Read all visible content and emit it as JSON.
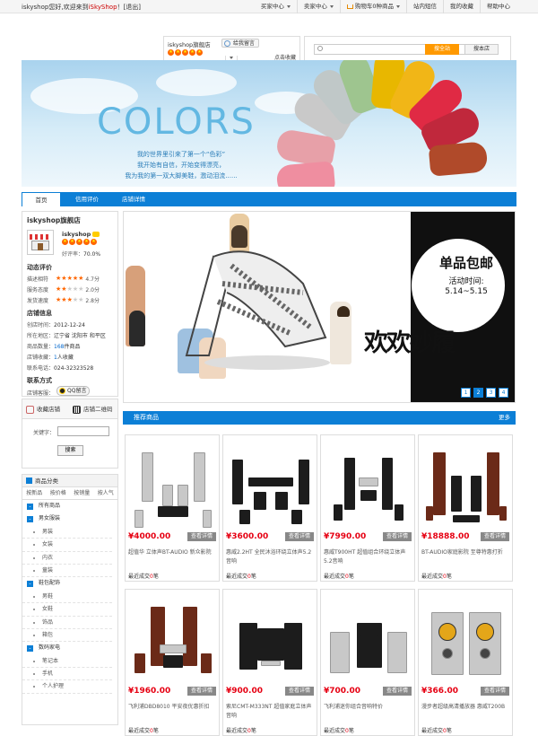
{
  "topbar": {
    "welcome_prefix": "iskyshop您好,欢迎来到",
    "welcome_shop": "iSkyShop",
    "welcome_suffix": "！[退出]",
    "nav": [
      "买家中心",
      "卖家中心",
      "购物车0种商品",
      "站内短信",
      "我的收藏",
      "帮助中心"
    ]
  },
  "header": {
    "shop_name": "iskyshop旗舰店",
    "fav_label": "给我留言",
    "collect_label": "点击收藏",
    "search_placeholder": "",
    "search_all_label": "搜全站",
    "search_shop_label": "搜本店"
  },
  "banner": {
    "headline": "COLORS",
    "slogan_1": "我的世界里引来了第一个“色彩”",
    "slogan_2": "我开始有自信，开始变得漂亮，",
    "slogan_3": "我为我的第一双大脚美鞋，激动泪流......"
  },
  "navbar": {
    "tabs": [
      "首页",
      "信用评价",
      "店铺详情"
    ]
  },
  "shop": {
    "title": "iskyshop旗舰店",
    "seller": "iskyshop",
    "rate_label": "好评率：",
    "rate_value": "70.0%",
    "dsr_title": "动态评价",
    "dsr": [
      {
        "label": "描述相符",
        "stars": 5,
        "score": "4.7分"
      },
      {
        "label": "服务态度",
        "stars": 2,
        "score": "2.0分"
      },
      {
        "label": "发货速度",
        "stars": 3,
        "score": "2.8分"
      }
    ],
    "info_title": "店铺信息",
    "info": [
      {
        "label": "创店时间：",
        "value": "2012-12-24"
      },
      {
        "label": "所在地区：",
        "value": "辽宁省 沈阳市 和平区"
      },
      {
        "label": "商品数量：",
        "value": "168件商品",
        "hl": "168"
      },
      {
        "label": "店铺收藏：",
        "value": "1人收藏",
        "hl": "1"
      },
      {
        "label": "联系电话：",
        "value": "024-32323528"
      }
    ],
    "contact_title": "联系方式",
    "service_label": "店铺客服：",
    "qq_label": "QQ留言"
  },
  "tools": {
    "fav_shop": "收藏店铺",
    "qr_code": "店铺二维码"
  },
  "shop_search": {
    "keyword_label": "关键字：",
    "button": "搜索"
  },
  "categories": {
    "title": "商品分类",
    "sorts": [
      "按新品",
      "按价格",
      "按销量",
      "按人气"
    ],
    "items": [
      {
        "type": "top",
        "label": "所有商品"
      },
      {
        "type": "top",
        "label": "男女服装"
      },
      {
        "type": "sub",
        "label": "男装"
      },
      {
        "type": "sub",
        "label": "女装"
      },
      {
        "type": "sub",
        "label": "内衣"
      },
      {
        "type": "sub",
        "label": "童装"
      },
      {
        "type": "top",
        "label": "鞋包配饰"
      },
      {
        "type": "sub",
        "label": "男鞋"
      },
      {
        "type": "sub",
        "label": "女鞋"
      },
      {
        "type": "sub",
        "label": "饰品"
      },
      {
        "type": "sub",
        "label": "箱包"
      },
      {
        "type": "top",
        "label": "数码家电"
      },
      {
        "type": "sub",
        "label": "笔记本"
      },
      {
        "type": "sub",
        "label": "手机"
      },
      {
        "type": "sub",
        "label": "个人护理"
      }
    ]
  },
  "promo": {
    "badge_title": "单品包邮",
    "badge_line1": "活动时间:",
    "badge_line2": "5.14~5.15",
    "slogan": "欢欢妙履",
    "pages": [
      "1",
      "2",
      "3",
      "4"
    ],
    "active_page": "2"
  },
  "recommend": {
    "title": "推荐商品",
    "more": "更多",
    "detail_label": "查看详情",
    "sold_prefix": "最近成交",
    "sold_suffix": "笔",
    "products": [
      {
        "price": "¥4000.00",
        "name": "超值华 立体声BT-AUDIO 新众影院",
        "sold": "0"
      },
      {
        "price": "¥3600.00",
        "name": "惠威2.2HT 全民沐浴环绕立体声5.2音响",
        "sold": "0"
      },
      {
        "price": "¥7990.00",
        "name": "惠威T900HT 超值组合环绕立体声5.2音响",
        "sold": "0"
      },
      {
        "price": "¥18888.00",
        "name": "BT-AUDIO家庭影院 至尊特惠打折",
        "sold": "0"
      },
      {
        "price": "¥1960.00",
        "name": "飞利浦DBD8010 平安夜优惠折扣",
        "sold": "0"
      },
      {
        "price": "¥900.00",
        "name": "索尼CMT-M333NT 超值家庭立体声音响",
        "sold": "0"
      },
      {
        "price": "¥700.00",
        "name": "飞利浦迷你组合音响特价",
        "sold": "0"
      },
      {
        "price": "¥366.00",
        "name": "漫步者超级高清播放器 惠威T200B",
        "sold": "0"
      }
    ]
  },
  "colors": {
    "accent": "#0c7fd6",
    "price": "#e60012",
    "search": "#ff9900"
  }
}
